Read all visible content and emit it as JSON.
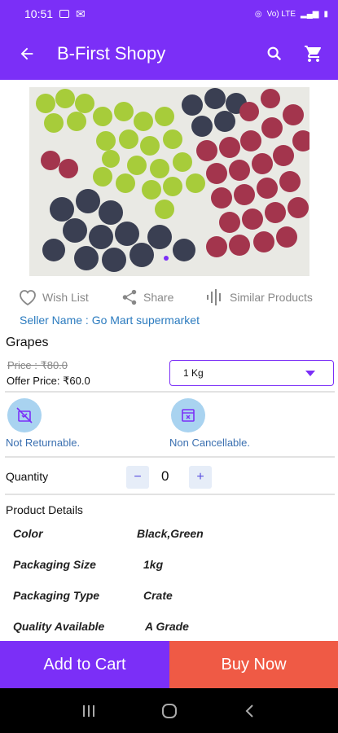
{
  "status": {
    "time": "10:51",
    "right_text": "Vo) LTE",
    "battery": "▮"
  },
  "header": {
    "title": "B-First Shopy"
  },
  "actions": {
    "wishlist": "Wish List",
    "share": "Share",
    "similar": "Similar Products"
  },
  "seller": {
    "label": "Seller Name : Go Mart supermarket"
  },
  "product": {
    "name": "Grapes",
    "price": "Price : ₹80.0",
    "offer": "Offer Price: ₹60.0",
    "size_selected": "1 Kg"
  },
  "policies": {
    "returnable": "Not Returnable.",
    "cancellable": "Non Cancellable."
  },
  "quantity": {
    "label": "Quantity",
    "value": "0",
    "minus": "−",
    "plus": "+"
  },
  "details": {
    "title": "Product Details",
    "rows": [
      {
        "k": "Color",
        "v": "Black,Green"
      },
      {
        "k": "Packaging Size",
        "v": "1kg"
      },
      {
        "k": "Packaging Type",
        "v": "Crate"
      },
      {
        "k": "Quality Available",
        "v": "A Grade"
      }
    ]
  },
  "buttons": {
    "add_to_cart": "Add to Cart",
    "buy_now": "Buy Now"
  },
  "colors": {
    "primary": "#7b2ff7",
    "buy": "#ef5a45",
    "link": "#2b7bbf"
  }
}
